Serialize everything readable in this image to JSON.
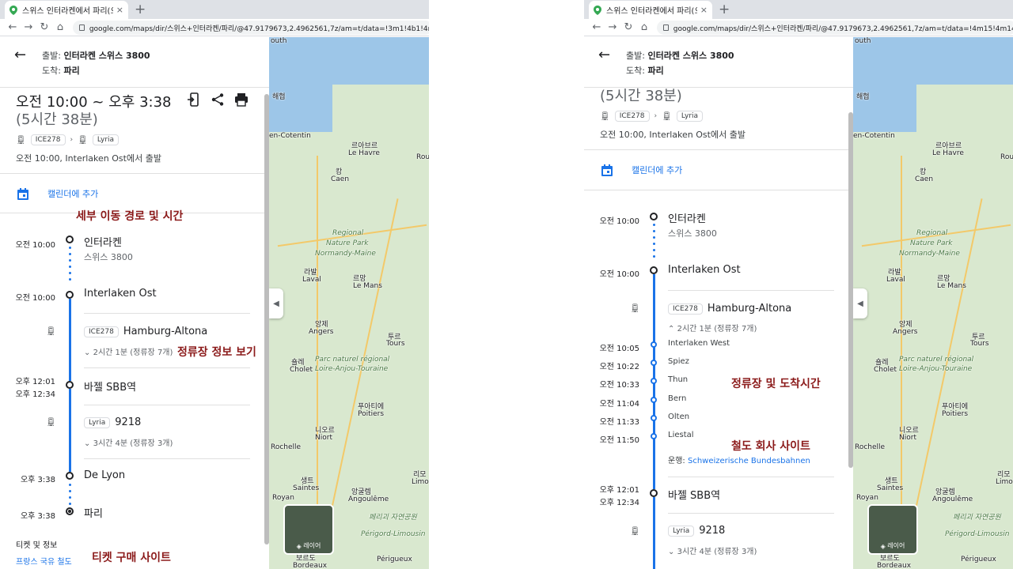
{
  "tab": {
    "title": "스위스 인터라켄에서 파리(으)로",
    "close": "×"
  },
  "newtab": "+",
  "url": "google.com/maps/dir/스위스+인터라켄/파리/@47.9179673,2.4962561,7z/am=t/data=!3m1!4b1!4m15",
  "url_right": "google.com/maps/dir/스위스+인터라켄/파리/@47.9179673,2.4962561,7z/am=t/data=!4m15!4m14!1m",
  "route": {
    "from_label": "출발:",
    "from": "인터라켄 스위스 3800",
    "to_label": "도착:",
    "to": "파리"
  },
  "summary": {
    "time": "오전 10:00 ~ 오후 3:38",
    "duration": "(5시간 38분)",
    "train1": "ICE278",
    "train2": "Lyria",
    "depart": "오전 10:00, Interlaken Ost에서 출발"
  },
  "calendar": "캘린더에 추가",
  "annotations": {
    "route_detail": "세부 이동 경로 및 시간",
    "stops_view": "정류장 정보 보기",
    "ticket_site": "티켓 구매 사이트",
    "stops_times": "정류장 및 도착시간",
    "rail_site": "철도 회사 사이트"
  },
  "timeline": {
    "t1": "오전 10:00",
    "n1": "인터라켄",
    "s1": "스위스 3800",
    "t2": "오전 10:00",
    "n2": "Interlaken Ost",
    "leg1_code": "ICE278",
    "leg1_dest": "Hamburg-Altona",
    "leg1_info": "2시간 1분 (정류장 7개)",
    "t3a": "오후 12:01",
    "t3b": "오후 12:34",
    "n3": "바젤 SBB역",
    "leg2_code": "Lyria",
    "leg2_num": "9218",
    "leg2_info": "3시간 4분 (정류장 3개)",
    "t4": "오후 3:38",
    "n4": "De Lyon",
    "t5": "오후 3:38",
    "n5": "파리"
  },
  "stops": [
    {
      "time": "오전 10:05",
      "name": "Interlaken West"
    },
    {
      "time": "오전 10:22",
      "name": "Spiez"
    },
    {
      "time": "오전 10:33",
      "name": "Thun"
    },
    {
      "time": "오전 11:04",
      "name": "Bern"
    },
    {
      "time": "오전 11:33",
      "name": "Olten"
    },
    {
      "time": "오전 11:50",
      "name": "Liestal"
    }
  ],
  "operator": {
    "label": "운행:",
    "name": "Schweizerische Bundesbahnen"
  },
  "tickets": {
    "heading": "티켓 및 정보",
    "link": "프랑스 국유 철도"
  },
  "map": {
    "labels": [
      "outh",
      "해협",
      "르아브르",
      "Le Havre",
      "캉",
      "Caen",
      "Regional",
      "Nature Park",
      "Normandy-Maine",
      "르망",
      "Le Mans",
      "라발",
      "Laval",
      "앙제",
      "Angers",
      "투르",
      "Tours",
      "Parc naturel régional",
      "Loire-Anjou-Touraine",
      "숄레",
      "Cholet",
      "푸아티에",
      "Poitiers",
      "니오르",
      "Niort",
      "Rochelle",
      "리모",
      "Limo",
      "생트",
      "Saintes",
      "앙굴렘",
      "Angoulême",
      "Royan",
      "페리괴 자연공원",
      "Périgord-Limousin",
      "보르도",
      "Bordeaux",
      "Périgueux",
      "en-Cotentin",
      "Rou"
    ],
    "layers": "레이어"
  },
  "colors": {
    "accent": "#1a73e8",
    "annotation": "#8b1a1a"
  },
  "icons": [
    "back-arrow-icon",
    "phone-send-icon",
    "share-icon",
    "print-icon",
    "train-icon",
    "calendar-icon",
    "chevron-up-icon",
    "chevron-down-icon",
    "layers-icon"
  ]
}
